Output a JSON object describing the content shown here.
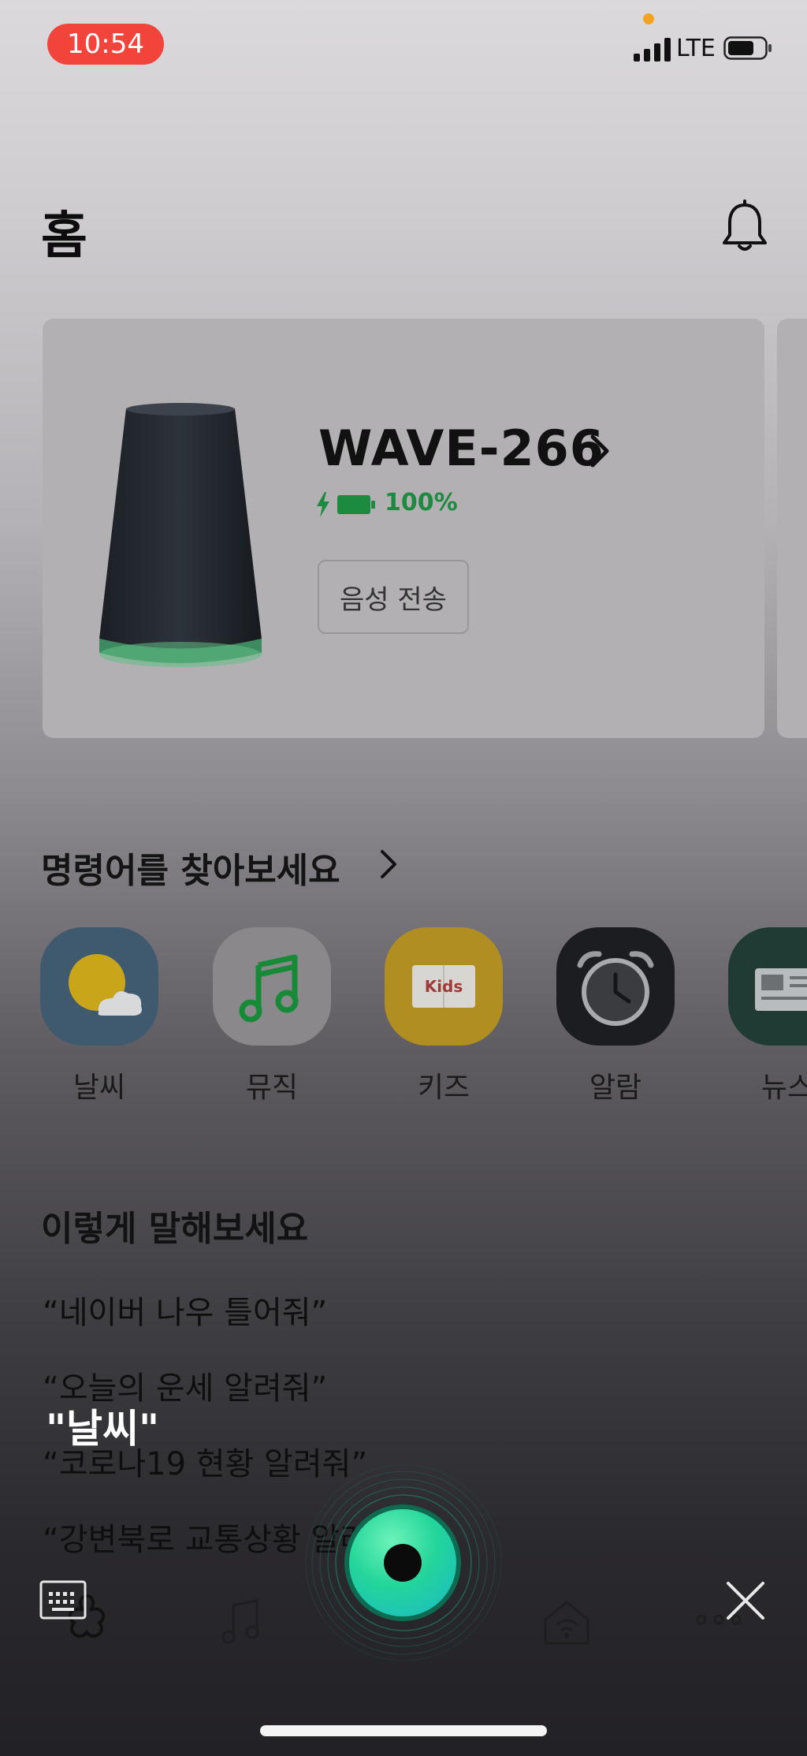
{
  "status": {
    "time": "10:54",
    "network": "LTE"
  },
  "header": {
    "title": "홈"
  },
  "device": {
    "name": "WAVE-266",
    "battery": "100%",
    "battery_level": 1.0,
    "voice_button": "음성 전송"
  },
  "commands": {
    "title": "명령어를 찾아보세요",
    "items": [
      {
        "label": "날씨",
        "icon": "weather-icon"
      },
      {
        "label": "뮤직",
        "icon": "music-note-icon"
      },
      {
        "label": "키즈",
        "icon": "kids-book-icon",
        "badge": "Kids"
      },
      {
        "label": "알람",
        "icon": "alarm-clock-icon"
      },
      {
        "label": "뉴스",
        "icon": "news-icon"
      }
    ]
  },
  "suggestions": {
    "title": "이렇게 말해보세요",
    "items": [
      "“네이버 나우 틀어줘”",
      "“오늘의 운세 알려줘”",
      "“코로나19 현황 알려줘”",
      "“강변북로 교통상황 알려줘”"
    ]
  },
  "voice_query": "\"날씨\"",
  "colors": {
    "accent": "#1c8a3f",
    "status_time_bg": "#f2443a",
    "mic_green": "#23d59a"
  }
}
